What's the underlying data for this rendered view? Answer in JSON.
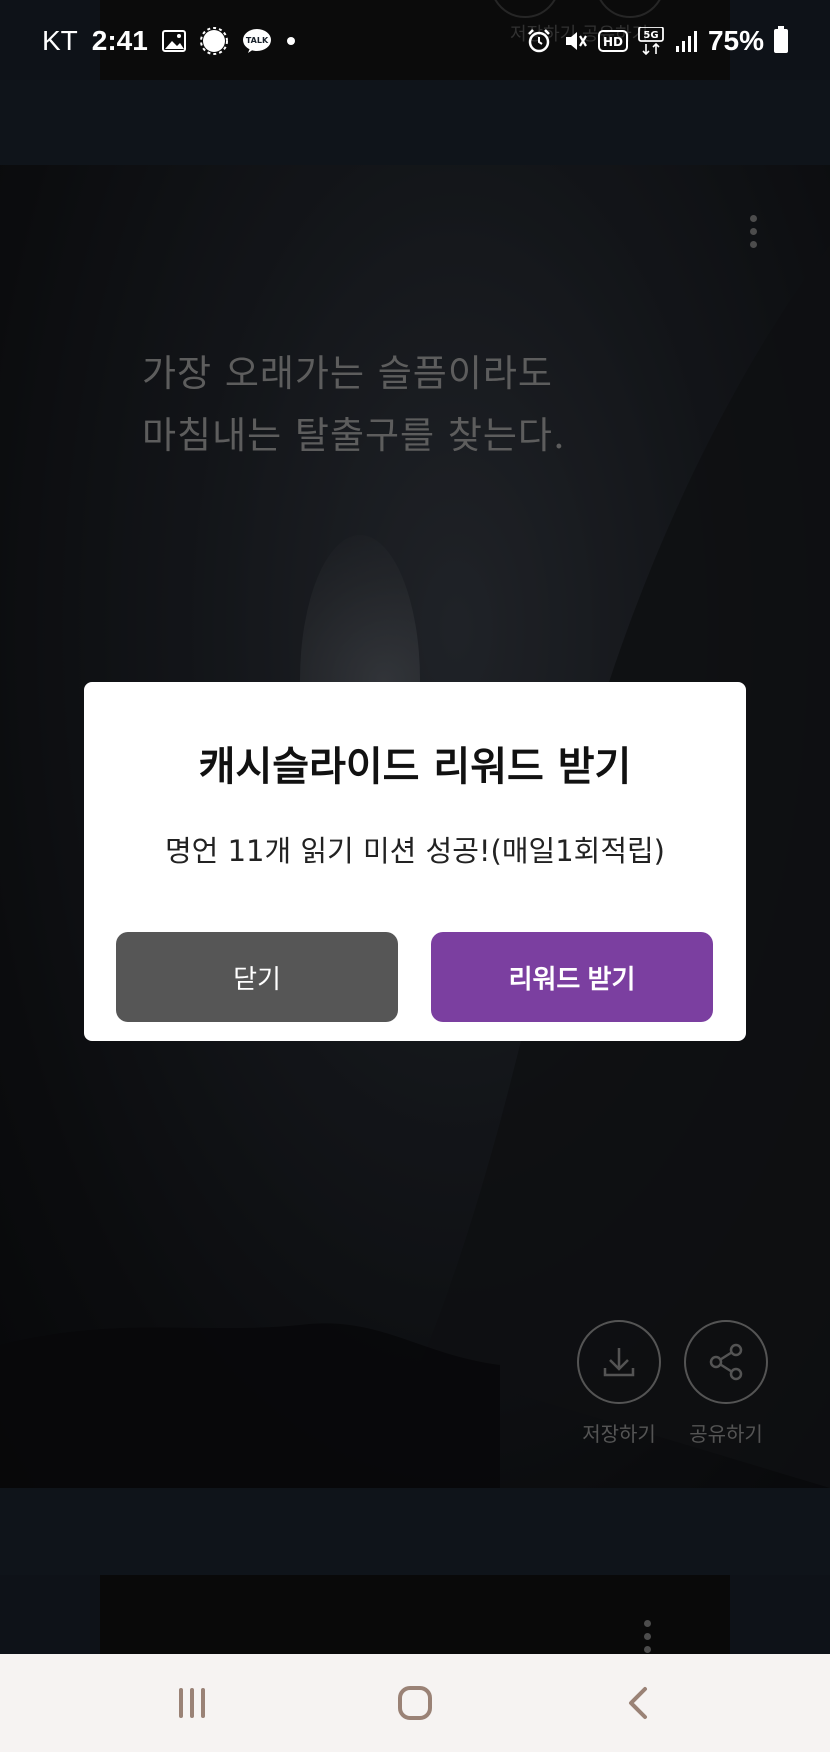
{
  "status_bar": {
    "carrier": "KT",
    "time": "2:41",
    "notification_icons": [
      "gallery-icon",
      "gear-badge-icon",
      "kakaotalk-icon",
      "dot-icon"
    ],
    "talk_label": "TALK",
    "system_icons": [
      "alarm-icon",
      "mute-vibrate-icon",
      "hd-icon",
      "5g-icon",
      "signal-icon"
    ],
    "hd_label": "HD",
    "network_label": "5G",
    "battery": "75%"
  },
  "background": {
    "top_card_partial_label": "저장하기 공유하기",
    "quote": {
      "line1": "가장 오래가는 슬픔이라도",
      "line2": "마침내는 탈출구를 찾는다."
    },
    "actions": {
      "save_label": "저장하기",
      "share_label": "공유하기"
    }
  },
  "dialog": {
    "title": "캐시슬라이드 리워드 받기",
    "message": "명언 11개 읽기 미션 성공!(매일1회적립)",
    "close_label": "닫기",
    "reward_label": "리워드 받기",
    "reward_color": "#7b3fa0",
    "close_color": "#565656"
  },
  "nav_bar": {
    "icons": [
      "recent-apps-icon",
      "home-icon",
      "back-icon"
    ]
  }
}
